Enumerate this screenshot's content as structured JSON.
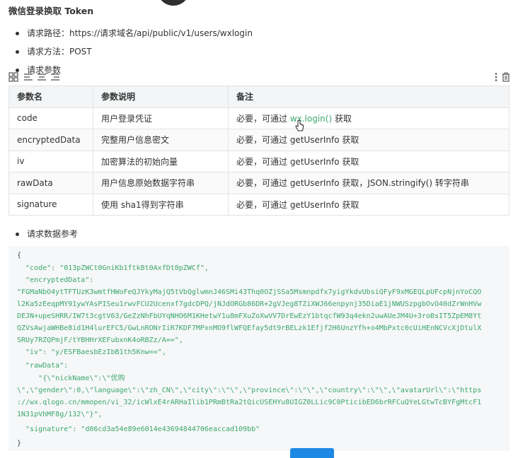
{
  "heading": "微信登录换取 Token",
  "bullets": {
    "path": "请求路径：https://请求域名/api/public/v1/users/wxlogin",
    "method": "请求方法：POST",
    "params": "请求参数"
  },
  "table": {
    "headers": [
      "参数名",
      "参数说明",
      "备注"
    ],
    "rows": [
      {
        "name": "code",
        "desc": "用户登录凭证",
        "note_prefix": "必要，可通过 ",
        "note_link": "wx.login()",
        "note_suffix": " 获取"
      },
      {
        "name": "encryptedData",
        "desc": "完整用户信息密文",
        "note": "必要，可通过 getUserInfo 获取"
      },
      {
        "name": "iv",
        "desc": "加密算法的初始向量",
        "note": "必要，可通过 getUserInfo 获取"
      },
      {
        "name": "rawData",
        "desc": "用户信息原始数据字符串",
        "note": "必要，可通过 getUserInfo 获取，JSON.stringify() 转字符串"
      },
      {
        "name": "signature",
        "desc": "使用 sha1得到字符串",
        "note": "必要，可通过 getUserInfo 获取"
      }
    ]
  },
  "request_example_label": "请求数据参考",
  "code_lines": [
    "{",
    "  \"code\": \"013pZWCt0GniKb1ftkBt0AxfDt0pZWCf\",",
    "  \"encryptedData\":",
    "\"FGMaNbO4ytTFTUzK3wmtfHWoFeQJYkyMajQ5tVbQglwmnJ46SMi43Thq0OZjSSa5Msmnpdfx7yigYkdvUbsiQFyF9xMGEQLpUFcpNjnYoCQO",
    "l2Ka5zEeqpMY91ywYAsPISeu1rwvFCU2Ucenxf7gdcDPQ/jNJdORGb86DR+2gVJeg8TZiXWJ66enpynj35DiaE1jNWUSzpgbOvO40dZrWnHVw",
    "DEJN+upeSHRR/IW7t3cgtV63/GeZzNhFbUYqNHO6M1KHetwY1u8mFXuZoXwVV7DrEwEzY1btqcfW93q4ekn2uwAUeJM4U+3roBsIT5ZpEM8Yt",
    "QZVsAwjaWHBe8id1H4lurEFC5/GwLnRONrIiR7KDF7MPxnMO9flWFQEfay5dt9rBELzk1Efjf2H6UnzYfh+o4MbPxtc0cUiHEnNCVcXjDtulX",
    "SRUy7RZQPmjF/tYBHHrXEFubxnK4oRBZz/A==\",",
    "  \"iv\": \"y/ESFBaesbEzIbB1th5Knw==\",",
    "  \"rawData\":",
    "     \"{\\\"nickName\\\":\\\"优购",
    "\\\",\\\"gender\\\":0,\\\"language\\\":\\\"zh_CN\\\",\\\"city\\\":\\\"\\\",\\\"province\\\":\\\"\\\",\\\"country\\\":\\\"\\\",\\\"avatarUrl\\\":\\\"https",
    "://wx.qlogo.cn/mmopen/vi_32/icWlxE4rARHaIlib1PRmBtRa2tQicUSEHYu8UIGZ0LLic9C0PticibED6brRFCuQYeLGtwTcBYFgMtcF1",
    "1N31pVhMF8g/132\\\"}\",",
    "  \"signature\": \"d06cd3a54e89e6014e43694844706eaccad109bb\"",
    "}"
  ]
}
